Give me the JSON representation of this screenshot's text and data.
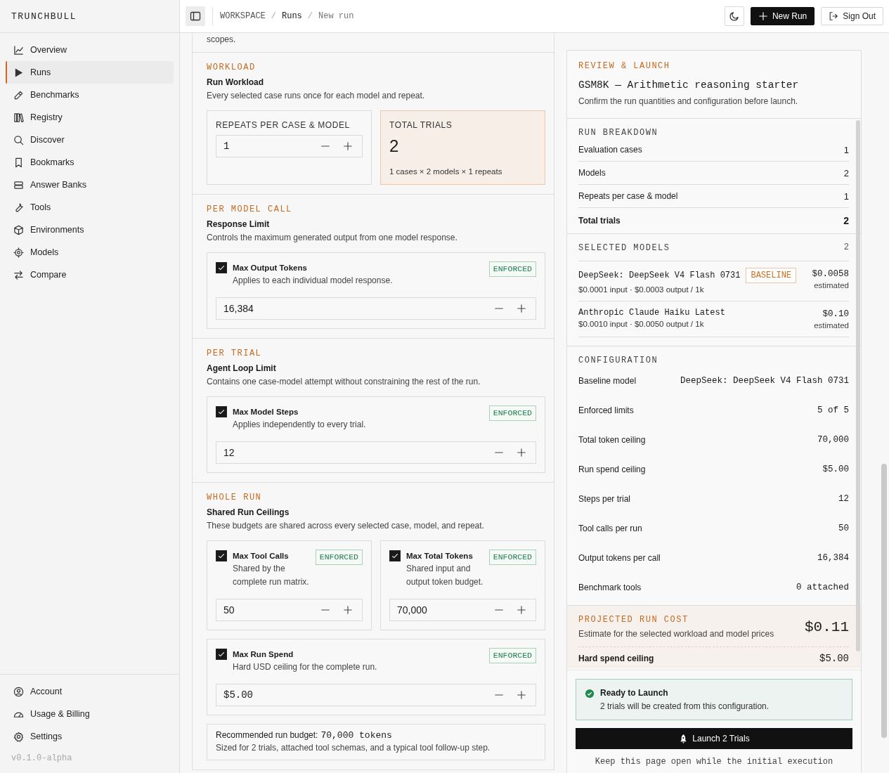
{
  "sidebar": {
    "brand": "TRUNCHBULL",
    "items": [
      {
        "label": "Overview",
        "selected": false
      },
      {
        "label": "Runs",
        "selected": true
      },
      {
        "label": "Benchmarks",
        "selected": false
      },
      {
        "label": "Registry",
        "selected": false
      },
      {
        "label": "Discover",
        "selected": false
      },
      {
        "label": "Bookmarks",
        "selected": false
      },
      {
        "label": "Answer Banks",
        "selected": false
      },
      {
        "label": "Tools",
        "selected": false
      },
      {
        "label": "Environments",
        "selected": false
      },
      {
        "label": "Models",
        "selected": false
      },
      {
        "label": "Compare",
        "selected": false
      }
    ],
    "footer_items": [
      {
        "label": "Account",
        "selected": false
      },
      {
        "label": "Usage & Billing",
        "selected": false
      },
      {
        "label": "Settings",
        "selected": false
      }
    ],
    "version": "v0.1.0-alpha"
  },
  "topbar": {
    "separator": "/",
    "breadcrumb": [
      {
        "label": "WORKSPACE",
        "kind": "root"
      },
      {
        "label": "Runs",
        "kind": "link"
      },
      {
        "label": "New run",
        "kind": "current"
      }
    ],
    "buttons": [
      {
        "label": "New Run",
        "kind": "primary"
      },
      {
        "label": "Sign Out",
        "kind": "secondary"
      }
    ]
  },
  "form": {
    "intro_tail": "scopes.",
    "sections": [
      {
        "kind": "workload",
        "eyebrow": "WORKLOAD",
        "title": "Run Workload",
        "description": "Every selected case runs once for each model and repeat.",
        "repeats": {
          "label": "REPEATS PER CASE & MODEL",
          "value": "1"
        },
        "total": {
          "label": "TOTAL TRIALS",
          "value": "2",
          "formula": "1 cases × 2 models × 1 repeats"
        }
      },
      {
        "kind": "limits",
        "eyebrow": "PER MODEL CALL",
        "title": "Response Limit",
        "description": "Controls the maximum generated output from one model response.",
        "limit_rows": [
          [
            {
              "name": "Max Output Tokens",
              "description": "Applies to each individual model response.",
              "checked": true,
              "badge": "ENFORCED",
              "value": "16,384",
              "kind": "count"
            }
          ]
        ]
      },
      {
        "kind": "limits",
        "eyebrow": "PER TRIAL",
        "title": "Agent Loop Limit",
        "description": "Contains one case-model attempt without constraining the rest of the run.",
        "limit_rows": [
          [
            {
              "name": "Max Model Steps",
              "description": "Applies independently to every trial.",
              "checked": true,
              "badge": "ENFORCED",
              "value": "12",
              "kind": "count"
            }
          ]
        ]
      },
      {
        "kind": "limits",
        "eyebrow": "WHOLE RUN",
        "title": "Shared Run Ceilings",
        "description": "These budgets are shared across every selected case, model, and repeat.",
        "limit_rows": [
          [
            {
              "name": "Max Tool Calls",
              "description": "Shared by the complete run matrix.",
              "checked": true,
              "badge": "ENFORCED",
              "value": "50",
              "kind": "count"
            },
            {
              "name": "Max Total Tokens",
              "description": "Shared input and output token budget.",
              "checked": true,
              "badge": "ENFORCED",
              "value": "70,000",
              "kind": "count"
            }
          ],
          [
            {
              "name": "Max Run Spend",
              "description": "Hard USD ceiling for the complete run.",
              "checked": true,
              "badge": "ENFORCED",
              "value": "$5.00",
              "kind": "currency"
            }
          ]
        ],
        "recommendation": {
          "label": "Recommended run budget:",
          "value": "70,000 tokens",
          "note": "Sized for 2 trials, attached tool schemas, and a typical tool follow-up step."
        }
      }
    ]
  },
  "review": {
    "eyebrow": "REVIEW & LAUNCH",
    "title": "GSM8K — Arithmetic reasoning starter",
    "description": "Confirm the run quantities and configuration before launch.",
    "breakdown": {
      "heading": "RUN BREAKDOWN",
      "rows": [
        {
          "label": "Evaluation cases",
          "value": "1",
          "kind": "item"
        },
        {
          "label": "Models",
          "value": "2",
          "kind": "item"
        },
        {
          "label": "Repeats per case & model",
          "value": "1",
          "kind": "item"
        },
        {
          "label": "Total trials",
          "value": "2",
          "kind": "total"
        }
      ]
    },
    "models": {
      "heading": "SELECTED MODELS",
      "count": "2",
      "items": [
        {
          "name": "DeepSeek: DeepSeek V4 Flash 0731",
          "badge": "BASELINE",
          "pricing": "$0.0001 input · $0.0003 output / 1k",
          "cost": "$0.0058",
          "cost_note": "estimated"
        },
        {
          "name": "Anthropic Claude Haiku Latest",
          "pricing": "$0.0010 input · $0.0050 output / 1k",
          "cost": "$0.10",
          "cost_note": "estimated"
        }
      ]
    },
    "configuration": {
      "heading": "CONFIGURATION",
      "rows": [
        {
          "label": "Baseline model",
          "value": "DeepSeek: DeepSeek V4 Flash 0731"
        },
        {
          "label": "Enforced limits",
          "value": "5 of 5"
        },
        {
          "label": "Total token ceiling",
          "value": "70,000"
        },
        {
          "label": "Run spend ceiling",
          "value": "$5.00"
        },
        {
          "label": "Steps per trial",
          "value": "12"
        },
        {
          "label": "Tool calls per run",
          "value": "50"
        },
        {
          "label": "Output tokens per call",
          "value": "16,384"
        },
        {
          "label": "Benchmark tools",
          "value": "0 attached"
        }
      ]
    },
    "projection": {
      "eyebrow": "PROJECTED RUN COST",
      "description": "Estimate for the selected workload and model prices",
      "amount": "$0.11",
      "ceiling_label": "Hard spend ceiling",
      "ceiling_value": "$5.00"
    },
    "status": {
      "title": "Ready to Launch",
      "message": "2 trials will be created from this configuration."
    },
    "launch": "Launch 2 Trials",
    "footnote": "Keep this page open while the initial execution"
  }
}
